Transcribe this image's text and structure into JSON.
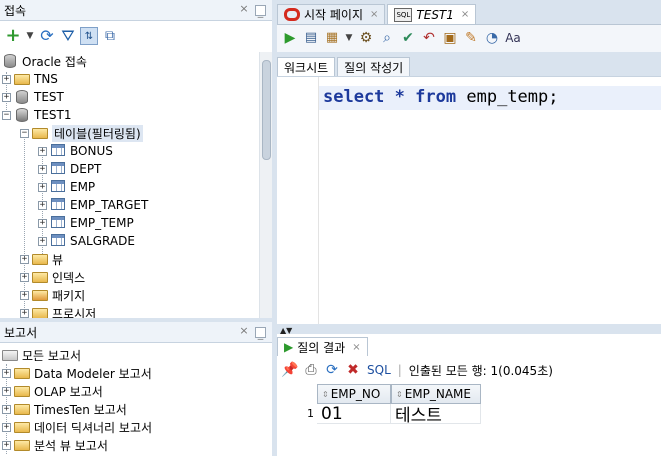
{
  "connections_panel": {
    "title": "접속",
    "tree": {
      "root": "Oracle 접속",
      "items": [
        {
          "label": "TNS"
        },
        {
          "label": "TEST"
        },
        {
          "label": "TEST1"
        },
        {
          "label": "테이블(필터링됨)"
        },
        {
          "label": "BONUS"
        },
        {
          "label": "DEPT"
        },
        {
          "label": "EMP"
        },
        {
          "label": "EMP_TARGET"
        },
        {
          "label": "EMP_TEMP"
        },
        {
          "label": "SALGRADE"
        },
        {
          "label": "뷰"
        },
        {
          "label": "인덱스"
        },
        {
          "label": "패키지"
        },
        {
          "label": "프로시저"
        }
      ]
    }
  },
  "reports_panel": {
    "title": "보고서",
    "items": [
      {
        "label": "모든 보고서"
      },
      {
        "label": "Data Modeler 보고서"
      },
      {
        "label": "OLAP 보고서"
      },
      {
        "label": "TimesTen 보고서"
      },
      {
        "label": "데이터 딕셔너리 보고서"
      },
      {
        "label": "분석 뷰 보고서"
      }
    ]
  },
  "editor": {
    "tabs": [
      {
        "label": "시작 페이지"
      },
      {
        "label": "TEST1"
      }
    ],
    "subtabs": [
      {
        "label": "워크시트"
      },
      {
        "label": "질의 작성기"
      }
    ],
    "code": {
      "kw1": "select",
      "star": "*",
      "kw2": "from",
      "table": "emp_temp;"
    }
  },
  "results": {
    "tab_label": "질의 결과",
    "sql_label": "SQL",
    "status": "인출된 모든 행: 1(0.045초)",
    "columns": [
      "EMP_NO",
      "EMP_NAME"
    ],
    "rows": [
      {
        "num": "1",
        "cells": [
          "01",
          "테스트"
        ]
      }
    ]
  }
}
